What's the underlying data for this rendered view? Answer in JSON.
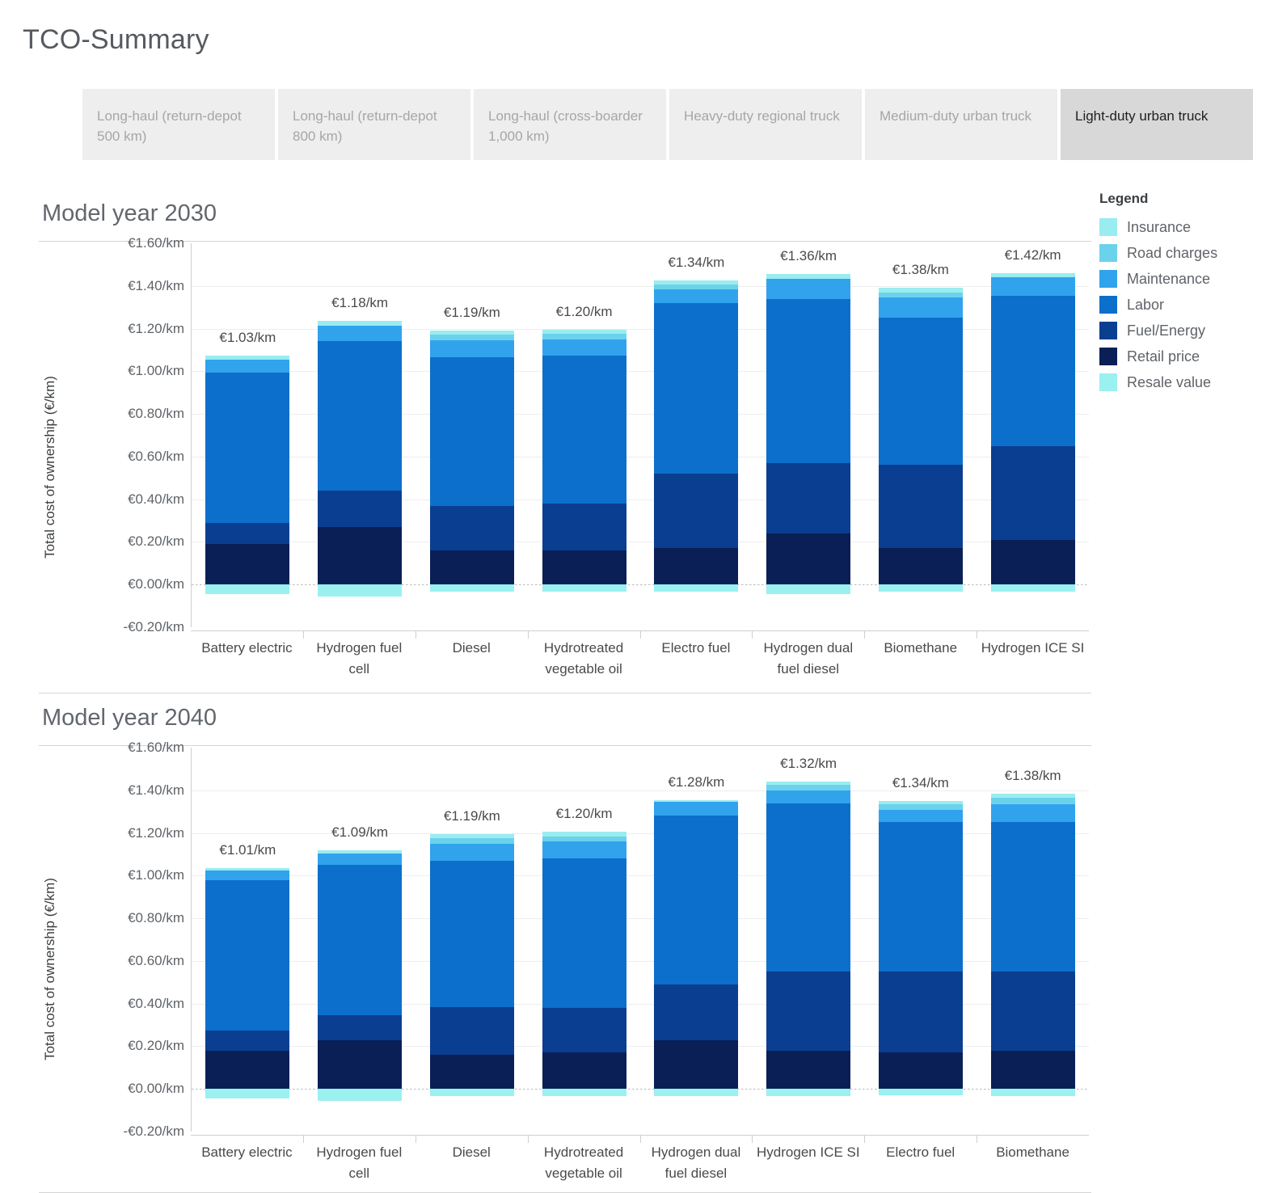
{
  "header": {
    "title": "TCO-Summary"
  },
  "tabs": [
    {
      "label": "Long-haul (return-depot 500 km)",
      "selected": false
    },
    {
      "label": "Long-haul (return-depot 800 km)",
      "selected": false
    },
    {
      "label": "Long-haul (cross-boarder 1,000 km)",
      "selected": false
    },
    {
      "label": "Heavy-duty regional truck",
      "selected": false
    },
    {
      "label": "Medium-duty urban truck",
      "selected": false
    },
    {
      "label": "Light-duty urban truck",
      "selected": true
    }
  ],
  "legend": {
    "title": "Legend",
    "items": [
      {
        "label": "Insurance",
        "color": "#99EDF0"
      },
      {
        "label": "Road charges",
        "color": "#6BD2EC"
      },
      {
        "label": "Maintenance",
        "color": "#31A3ED"
      },
      {
        "label": "Labor",
        "color": "#0C6FCC"
      },
      {
        "label": "Fuel/Energy",
        "color": "#0A3E90"
      },
      {
        "label": "Retail price",
        "color": "#0A1F55"
      },
      {
        "label": "Resale value",
        "color": "#9BF0F0"
      }
    ]
  },
  "sections": [
    {
      "title": "Model year 2030"
    },
    {
      "title": "Model year 2040"
    }
  ],
  "chart_data": [
    {
      "type": "bar",
      "stacked": true,
      "title": "Model year 2030",
      "xlabel": "",
      "ylabel": "Total cost of ownership (€/km)",
      "ylim": [
        -0.2,
        1.6
      ],
      "ytick_values": [
        1.6,
        1.4,
        1.2,
        1.0,
        0.8,
        0.6,
        0.4,
        0.2,
        0.0,
        -0.2
      ],
      "ytick_labels": [
        "€1.60/km",
        "€1.40/km",
        "€1.20/km",
        "€1.00/km",
        "€0.80/km",
        "€0.60/km",
        "€0.40/km",
        "€0.20/km",
        "€0.00/km",
        "-€0.20/km"
      ],
      "grid": true,
      "legend_position": "right",
      "categories": [
        "Battery electric",
        "Hydrogen fuel cell",
        "Diesel",
        "Hydrotreated vegetable oil",
        "Electro fuel",
        "Hydrogen dual fuel diesel",
        "Biomethane",
        "Hydrogen ICE SI"
      ],
      "bar_labels": [
        "€1.03/km",
        "€1.18/km",
        "€1.19/km",
        "€1.20/km",
        "€1.34/km",
        "€1.36/km",
        "€1.38/km",
        "€1.42/km"
      ],
      "totals": [
        1.03,
        1.18,
        1.19,
        1.2,
        1.34,
        1.36,
        1.38,
        1.42
      ],
      "series": [
        {
          "name": "Retail price",
          "color": "#0A1F55",
          "values": [
            0.19,
            0.27,
            0.16,
            0.16,
            0.17,
            0.24,
            0.17,
            0.21
          ]
        },
        {
          "name": "Fuel/Energy",
          "color": "#0A3E90",
          "values": [
            0.1,
            0.17,
            0.21,
            0.22,
            0.35,
            0.33,
            0.39,
            0.44
          ]
        },
        {
          "name": "Labor",
          "color": "#0C6FCC",
          "values": [
            0.705,
            0.7,
            0.695,
            0.695,
            0.8,
            0.77,
            0.69,
            0.705
          ]
        },
        {
          "name": "Maintenance",
          "color": "#31A3ED",
          "values": [
            0.06,
            0.075,
            0.08,
            0.075,
            0.065,
            0.095,
            0.095,
            0.085
          ]
        },
        {
          "name": "Road charges",
          "color": "#6BD2EC",
          "values": [
            0.0,
            0.0,
            0.025,
            0.025,
            0.02,
            0.0,
            0.025,
            0.0
          ]
        },
        {
          "name": "Insurance",
          "color": "#99EDF0",
          "values": [
            0.02,
            0.02,
            0.02,
            0.02,
            0.02,
            0.02,
            0.02,
            0.02
          ]
        },
        {
          "name": "Resale value",
          "color": "#9BF0F0",
          "values": [
            -0.045,
            -0.055,
            -0.035,
            -0.035,
            -0.035,
            -0.045,
            -0.035,
            -0.035
          ]
        }
      ]
    },
    {
      "type": "bar",
      "stacked": true,
      "title": "Model year 2040",
      "xlabel": "",
      "ylabel": "Total cost of ownership (€/km)",
      "ylim": [
        -0.2,
        1.6
      ],
      "ytick_values": [
        1.6,
        1.4,
        1.2,
        1.0,
        0.8,
        0.6,
        0.4,
        0.2,
        0.0,
        -0.2
      ],
      "ytick_labels": [
        "€1.60/km",
        "€1.40/km",
        "€1.20/km",
        "€1.00/km",
        "€0.80/km",
        "€0.60/km",
        "€0.40/km",
        "€0.20/km",
        "€0.00/km",
        "-€0.20/km"
      ],
      "grid": true,
      "legend_position": "right",
      "categories": [
        "Battery electric",
        "Hydrogen fuel cell",
        "Diesel",
        "Hydrotreated vegetable oil",
        "Hydrogen dual fuel diesel",
        "Hydrogen ICE SI",
        "Electro fuel",
        "Biomethane"
      ],
      "bar_labels": [
        "€1.01/km",
        "€1.09/km",
        "€1.19/km",
        "€1.20/km",
        "€1.28/km",
        "€1.32/km",
        "€1.34/km",
        "€1.38/km"
      ],
      "totals": [
        1.01,
        1.09,
        1.19,
        1.2,
        1.28,
        1.32,
        1.34,
        1.38
      ],
      "series": [
        {
          "name": "Retail price",
          "color": "#0A1F55",
          "values": [
            0.18,
            0.23,
            0.16,
            0.17,
            0.23,
            0.18,
            0.17,
            0.18
          ]
        },
        {
          "name": "Fuel/Energy",
          "color": "#0A3E90",
          "values": [
            0.095,
            0.115,
            0.225,
            0.21,
            0.26,
            0.37,
            0.38,
            0.37
          ]
        },
        {
          "name": "Labor",
          "color": "#0C6FCC",
          "values": [
            0.705,
            0.705,
            0.685,
            0.7,
            0.79,
            0.79,
            0.7,
            0.7
          ]
        },
        {
          "name": "Maintenance",
          "color": "#31A3ED",
          "values": [
            0.045,
            0.055,
            0.08,
            0.08,
            0.065,
            0.06,
            0.06,
            0.085
          ]
        },
        {
          "name": "Road charges",
          "color": "#6BD2EC",
          "values": [
            0.0,
            0.0,
            0.025,
            0.025,
            0.0,
            0.025,
            0.025,
            0.03
          ]
        },
        {
          "name": "Insurance",
          "color": "#99EDF0",
          "values": [
            0.01,
            0.015,
            0.02,
            0.02,
            0.01,
            0.015,
            0.015,
            0.02
          ]
        },
        {
          "name": "Resale value",
          "color": "#9BF0F0",
          "values": [
            -0.045,
            -0.055,
            -0.035,
            -0.035,
            -0.035,
            -0.035,
            -0.03,
            -0.035
          ]
        }
      ]
    }
  ]
}
